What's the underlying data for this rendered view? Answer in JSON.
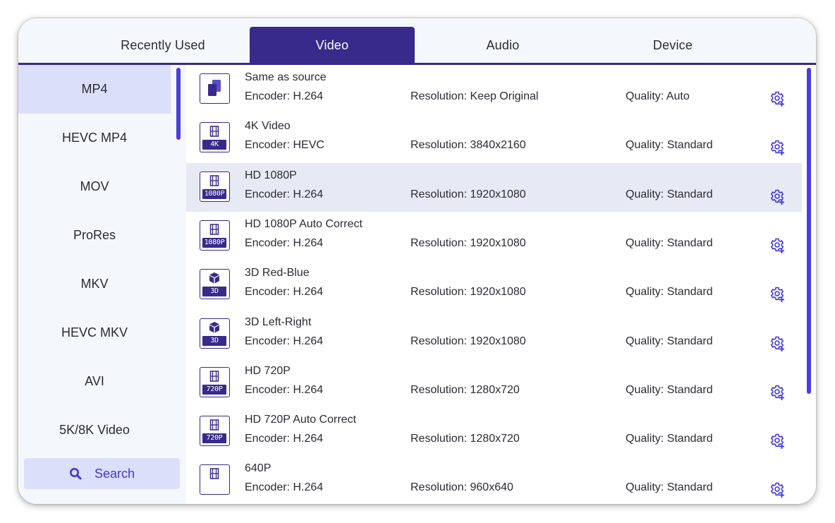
{
  "tabs": [
    {
      "label": "Recently Used",
      "active": false
    },
    {
      "label": "Video",
      "active": true
    },
    {
      "label": "Audio",
      "active": false
    },
    {
      "label": "Device",
      "active": false
    }
  ],
  "sidebar": {
    "items": [
      {
        "label": "MP4",
        "active": true
      },
      {
        "label": "HEVC MP4",
        "active": false
      },
      {
        "label": "MOV",
        "active": false
      },
      {
        "label": "ProRes",
        "active": false
      },
      {
        "label": "MKV",
        "active": false
      },
      {
        "label": "HEVC MKV",
        "active": false
      },
      {
        "label": "AVI",
        "active": false
      },
      {
        "label": "5K/8K Video",
        "active": false
      }
    ],
    "search_label": "Search",
    "search_icon": "search-icon"
  },
  "presets": [
    {
      "title": "Same as source",
      "encoder": "Encoder: H.264",
      "resolution": "Resolution: Keep Original",
      "quality": "Quality: Auto",
      "icon": "copy-icon",
      "badge": "",
      "active": false
    },
    {
      "title": "4K Video",
      "encoder": "Encoder: HEVC",
      "resolution": "Resolution: 3840x2160",
      "quality": "Quality: Standard",
      "icon": "film-icon",
      "badge": "4K",
      "active": false
    },
    {
      "title": "HD 1080P",
      "encoder": "Encoder: H.264",
      "resolution": "Resolution: 1920x1080",
      "quality": "Quality: Standard",
      "icon": "film-icon",
      "badge": "1080P",
      "active": true
    },
    {
      "title": "HD 1080P Auto Correct",
      "encoder": "Encoder: H.264",
      "resolution": "Resolution: 1920x1080",
      "quality": "Quality: Standard",
      "icon": "film-icon",
      "badge": "1080P",
      "active": false
    },
    {
      "title": "3D Red-Blue",
      "encoder": "Encoder: H.264",
      "resolution": "Resolution: 1920x1080",
      "quality": "Quality: Standard",
      "icon": "cube-icon",
      "badge": "3D",
      "active": false
    },
    {
      "title": "3D Left-Right",
      "encoder": "Encoder: H.264",
      "resolution": "Resolution: 1920x1080",
      "quality": "Quality: Standard",
      "icon": "cube-icon",
      "badge": "3D",
      "active": false
    },
    {
      "title": "HD 720P",
      "encoder": "Encoder: H.264",
      "resolution": "Resolution: 1280x720",
      "quality": "Quality: Standard",
      "icon": "film-icon",
      "badge": "720P",
      "active": false
    },
    {
      "title": "HD 720P Auto Correct",
      "encoder": "Encoder: H.264",
      "resolution": "Resolution: 1280x720",
      "quality": "Quality: Standard",
      "icon": "film-icon",
      "badge": "720P",
      "active": false
    },
    {
      "title": "640P",
      "encoder": "Encoder: H.264",
      "resolution": "Resolution: 960x640",
      "quality": "Quality: Standard",
      "icon": "film-icon",
      "badge": "",
      "active": false
    }
  ],
  "colors": {
    "accent": "#372a8a",
    "scrollbar": "#4a3ee0",
    "selected_bg": "#dcdff9",
    "row_highlight": "#e7eaf4",
    "gear": "#4236d8"
  }
}
